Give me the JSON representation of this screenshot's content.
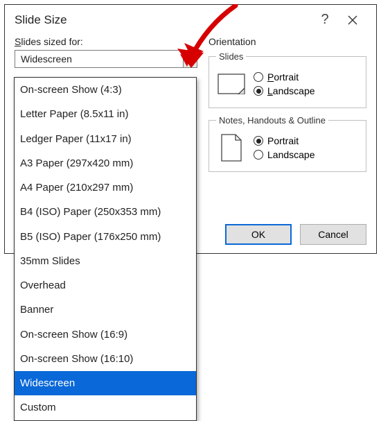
{
  "dialog": {
    "title": "Slide Size"
  },
  "left": {
    "label_pre": "S",
    "label_rest": "lides sized for:",
    "selected_value": "Widescreen",
    "options": [
      "On-screen Show (4:3)",
      "Letter Paper (8.5x11 in)",
      "Ledger Paper (11x17 in)",
      "A3 Paper (297x420 mm)",
      "A4 Paper (210x297 mm)",
      "B4 (ISO) Paper (250x353 mm)",
      "B5 (ISO) Paper (176x250 mm)",
      "35mm Slides",
      "Overhead",
      "Banner",
      "On-screen Show (16:9)",
      "On-screen Show (16:10)",
      "Widescreen",
      "Custom"
    ],
    "selected_index": 12
  },
  "right": {
    "heading": "Orientation",
    "slides_legend": "Slides",
    "notes_legend": "Notes, Handouts & Outline",
    "portrait_u": "P",
    "portrait_rest": "ortrait",
    "landscape_u": "L",
    "landscape_rest": "andscape",
    "portrait2": "Portrait",
    "landscape2": "Landscape",
    "slides_selected": "landscape",
    "notes_selected": "portrait"
  },
  "buttons": {
    "ok": "OK",
    "cancel": "Cancel"
  },
  "icons": {
    "help": "?"
  }
}
